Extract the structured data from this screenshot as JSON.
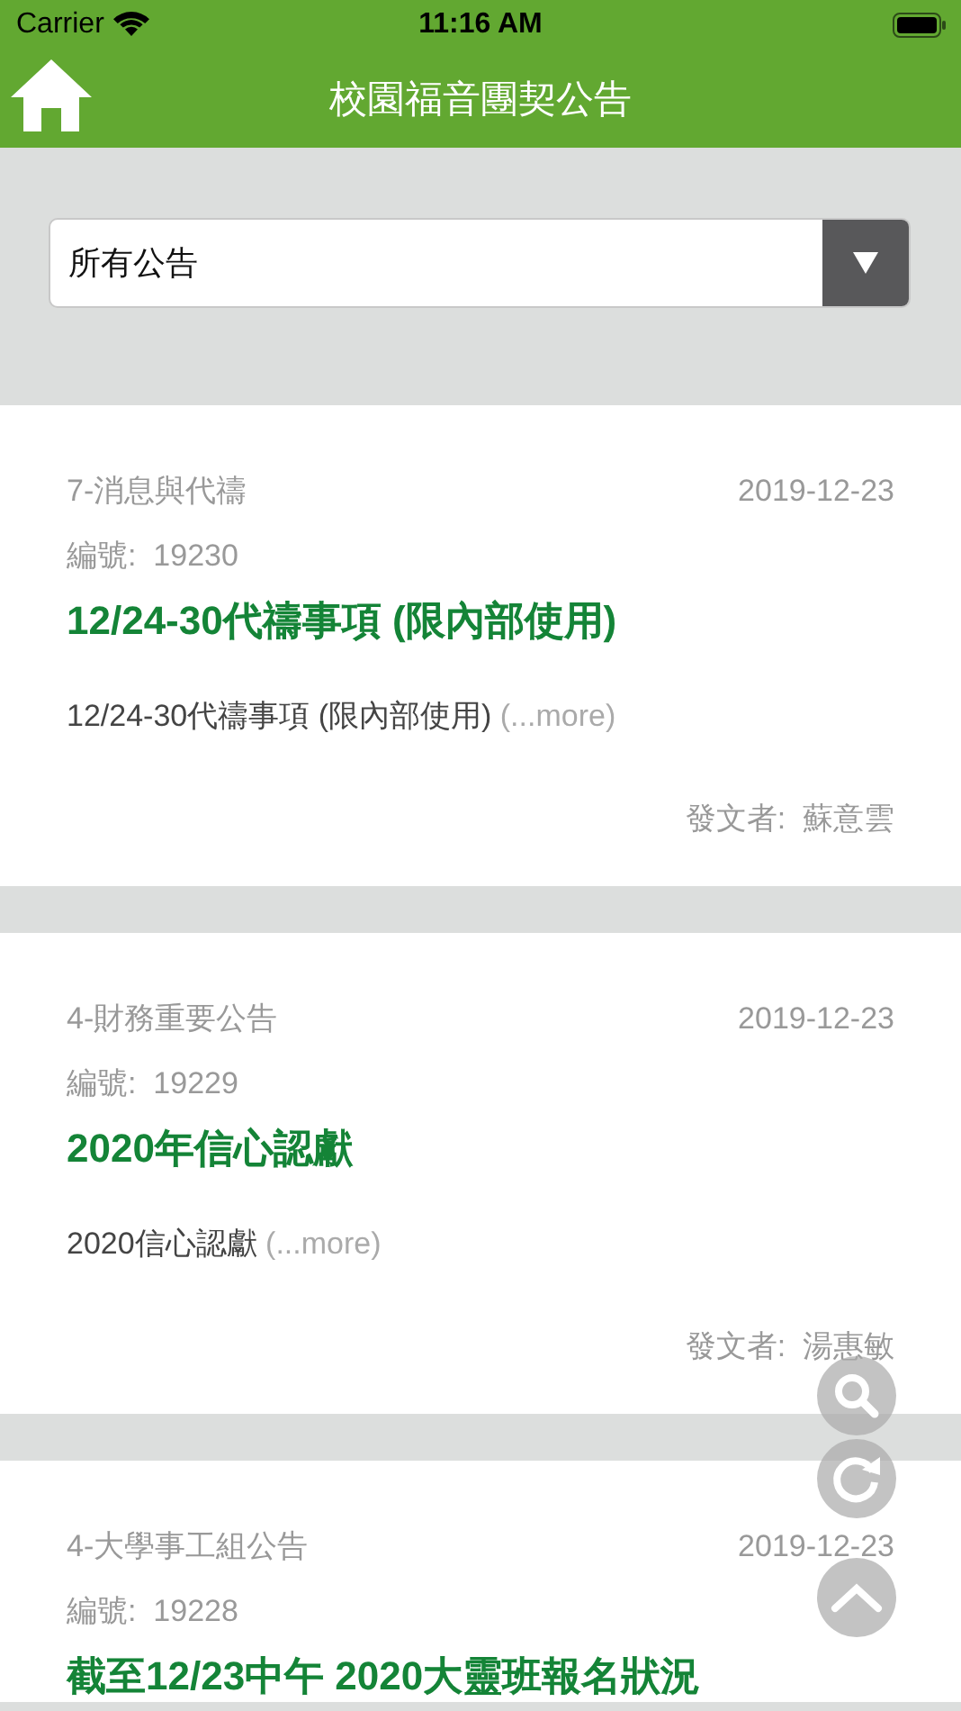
{
  "status_bar": {
    "carrier": "Carrier",
    "time": "11:16 AM"
  },
  "nav_bar": {
    "title": "校園福音團契公告"
  },
  "filter": {
    "value": "所有公告"
  },
  "notices": [
    {
      "category": "7-消息與代禱",
      "date": "2019-12-23",
      "number_label": "編號:",
      "number": "19230",
      "title": "12/24-30代禱事項 (限內部使用)",
      "excerpt": "12/24-30代禱事項 (限內部使用)",
      "more": "(...more)",
      "author_label": "發文者:",
      "author": "蘇意雲"
    },
    {
      "category": "4-財務重要公告",
      "date": "2019-12-23",
      "number_label": "編號:",
      "number": "19229",
      "title": "2020年信心認獻",
      "excerpt": "2020信心認獻",
      "more": "(...more)",
      "author_label": "發文者:",
      "author": "湯惠敏"
    },
    {
      "category": "4-大學事工組公告",
      "date": "2019-12-23",
      "number_label": "編號:",
      "number": "19228",
      "title": "截至12/23中午 2020大靈班報名狀況"
    }
  ],
  "floating_buttons": [
    {
      "kind": "search"
    },
    {
      "kind": "refresh"
    },
    {
      "kind": "top"
    }
  ]
}
